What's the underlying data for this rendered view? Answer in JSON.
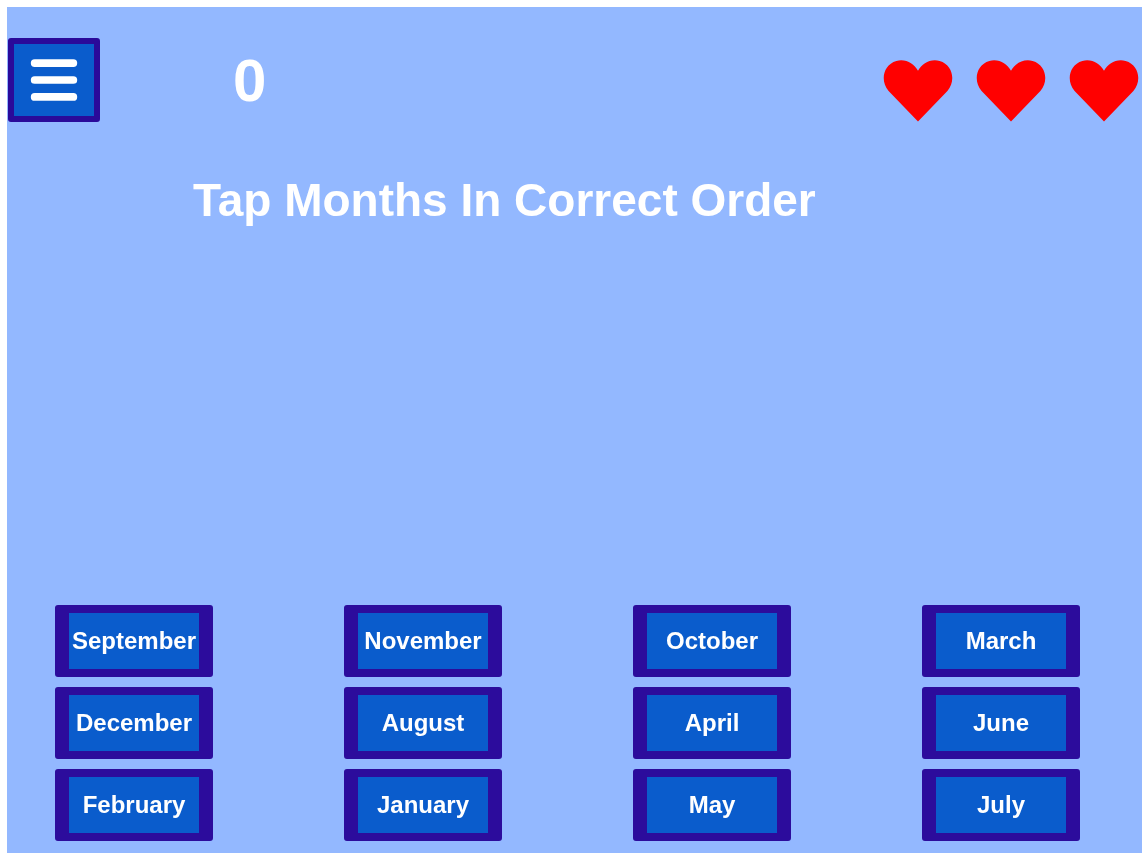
{
  "score": "0",
  "hearts": [
    {
      "filled": true
    },
    {
      "filled": true
    },
    {
      "filled": true
    }
  ],
  "title": "Tap Months In Correct Order",
  "months": [
    "September",
    "November",
    "October",
    "March",
    "December",
    "August",
    "April",
    "June",
    "February",
    "January",
    "May",
    "July"
  ]
}
